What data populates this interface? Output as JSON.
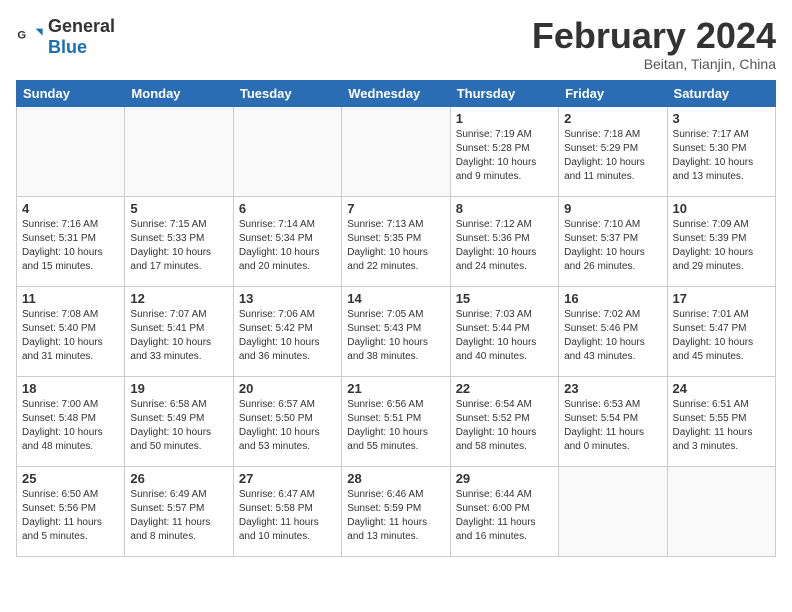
{
  "header": {
    "logo_general": "General",
    "logo_blue": "Blue",
    "main_title": "February 2024",
    "subtitle": "Beitan, Tianjin, China"
  },
  "weekdays": [
    "Sunday",
    "Monday",
    "Tuesday",
    "Wednesday",
    "Thursday",
    "Friday",
    "Saturday"
  ],
  "weeks": [
    [
      {
        "day": "",
        "info": ""
      },
      {
        "day": "",
        "info": ""
      },
      {
        "day": "",
        "info": ""
      },
      {
        "day": "",
        "info": ""
      },
      {
        "day": "1",
        "info": "Sunrise: 7:19 AM\nSunset: 5:28 PM\nDaylight: 10 hours\nand 9 minutes."
      },
      {
        "day": "2",
        "info": "Sunrise: 7:18 AM\nSunset: 5:29 PM\nDaylight: 10 hours\nand 11 minutes."
      },
      {
        "day": "3",
        "info": "Sunrise: 7:17 AM\nSunset: 5:30 PM\nDaylight: 10 hours\nand 13 minutes."
      }
    ],
    [
      {
        "day": "4",
        "info": "Sunrise: 7:16 AM\nSunset: 5:31 PM\nDaylight: 10 hours\nand 15 minutes."
      },
      {
        "day": "5",
        "info": "Sunrise: 7:15 AM\nSunset: 5:33 PM\nDaylight: 10 hours\nand 17 minutes."
      },
      {
        "day": "6",
        "info": "Sunrise: 7:14 AM\nSunset: 5:34 PM\nDaylight: 10 hours\nand 20 minutes."
      },
      {
        "day": "7",
        "info": "Sunrise: 7:13 AM\nSunset: 5:35 PM\nDaylight: 10 hours\nand 22 minutes."
      },
      {
        "day": "8",
        "info": "Sunrise: 7:12 AM\nSunset: 5:36 PM\nDaylight: 10 hours\nand 24 minutes."
      },
      {
        "day": "9",
        "info": "Sunrise: 7:10 AM\nSunset: 5:37 PM\nDaylight: 10 hours\nand 26 minutes."
      },
      {
        "day": "10",
        "info": "Sunrise: 7:09 AM\nSunset: 5:39 PM\nDaylight: 10 hours\nand 29 minutes."
      }
    ],
    [
      {
        "day": "11",
        "info": "Sunrise: 7:08 AM\nSunset: 5:40 PM\nDaylight: 10 hours\nand 31 minutes."
      },
      {
        "day": "12",
        "info": "Sunrise: 7:07 AM\nSunset: 5:41 PM\nDaylight: 10 hours\nand 33 minutes."
      },
      {
        "day": "13",
        "info": "Sunrise: 7:06 AM\nSunset: 5:42 PM\nDaylight: 10 hours\nand 36 minutes."
      },
      {
        "day": "14",
        "info": "Sunrise: 7:05 AM\nSunset: 5:43 PM\nDaylight: 10 hours\nand 38 minutes."
      },
      {
        "day": "15",
        "info": "Sunrise: 7:03 AM\nSunset: 5:44 PM\nDaylight: 10 hours\nand 40 minutes."
      },
      {
        "day": "16",
        "info": "Sunrise: 7:02 AM\nSunset: 5:46 PM\nDaylight: 10 hours\nand 43 minutes."
      },
      {
        "day": "17",
        "info": "Sunrise: 7:01 AM\nSunset: 5:47 PM\nDaylight: 10 hours\nand 45 minutes."
      }
    ],
    [
      {
        "day": "18",
        "info": "Sunrise: 7:00 AM\nSunset: 5:48 PM\nDaylight: 10 hours\nand 48 minutes."
      },
      {
        "day": "19",
        "info": "Sunrise: 6:58 AM\nSunset: 5:49 PM\nDaylight: 10 hours\nand 50 minutes."
      },
      {
        "day": "20",
        "info": "Sunrise: 6:57 AM\nSunset: 5:50 PM\nDaylight: 10 hours\nand 53 minutes."
      },
      {
        "day": "21",
        "info": "Sunrise: 6:56 AM\nSunset: 5:51 PM\nDaylight: 10 hours\nand 55 minutes."
      },
      {
        "day": "22",
        "info": "Sunrise: 6:54 AM\nSunset: 5:52 PM\nDaylight: 10 hours\nand 58 minutes."
      },
      {
        "day": "23",
        "info": "Sunrise: 6:53 AM\nSunset: 5:54 PM\nDaylight: 11 hours\nand 0 minutes."
      },
      {
        "day": "24",
        "info": "Sunrise: 6:51 AM\nSunset: 5:55 PM\nDaylight: 11 hours\nand 3 minutes."
      }
    ],
    [
      {
        "day": "25",
        "info": "Sunrise: 6:50 AM\nSunset: 5:56 PM\nDaylight: 11 hours\nand 5 minutes."
      },
      {
        "day": "26",
        "info": "Sunrise: 6:49 AM\nSunset: 5:57 PM\nDaylight: 11 hours\nand 8 minutes."
      },
      {
        "day": "27",
        "info": "Sunrise: 6:47 AM\nSunset: 5:58 PM\nDaylight: 11 hours\nand 10 minutes."
      },
      {
        "day": "28",
        "info": "Sunrise: 6:46 AM\nSunset: 5:59 PM\nDaylight: 11 hours\nand 13 minutes."
      },
      {
        "day": "29",
        "info": "Sunrise: 6:44 AM\nSunset: 6:00 PM\nDaylight: 11 hours\nand 16 minutes."
      },
      {
        "day": "",
        "info": ""
      },
      {
        "day": "",
        "info": ""
      }
    ]
  ]
}
